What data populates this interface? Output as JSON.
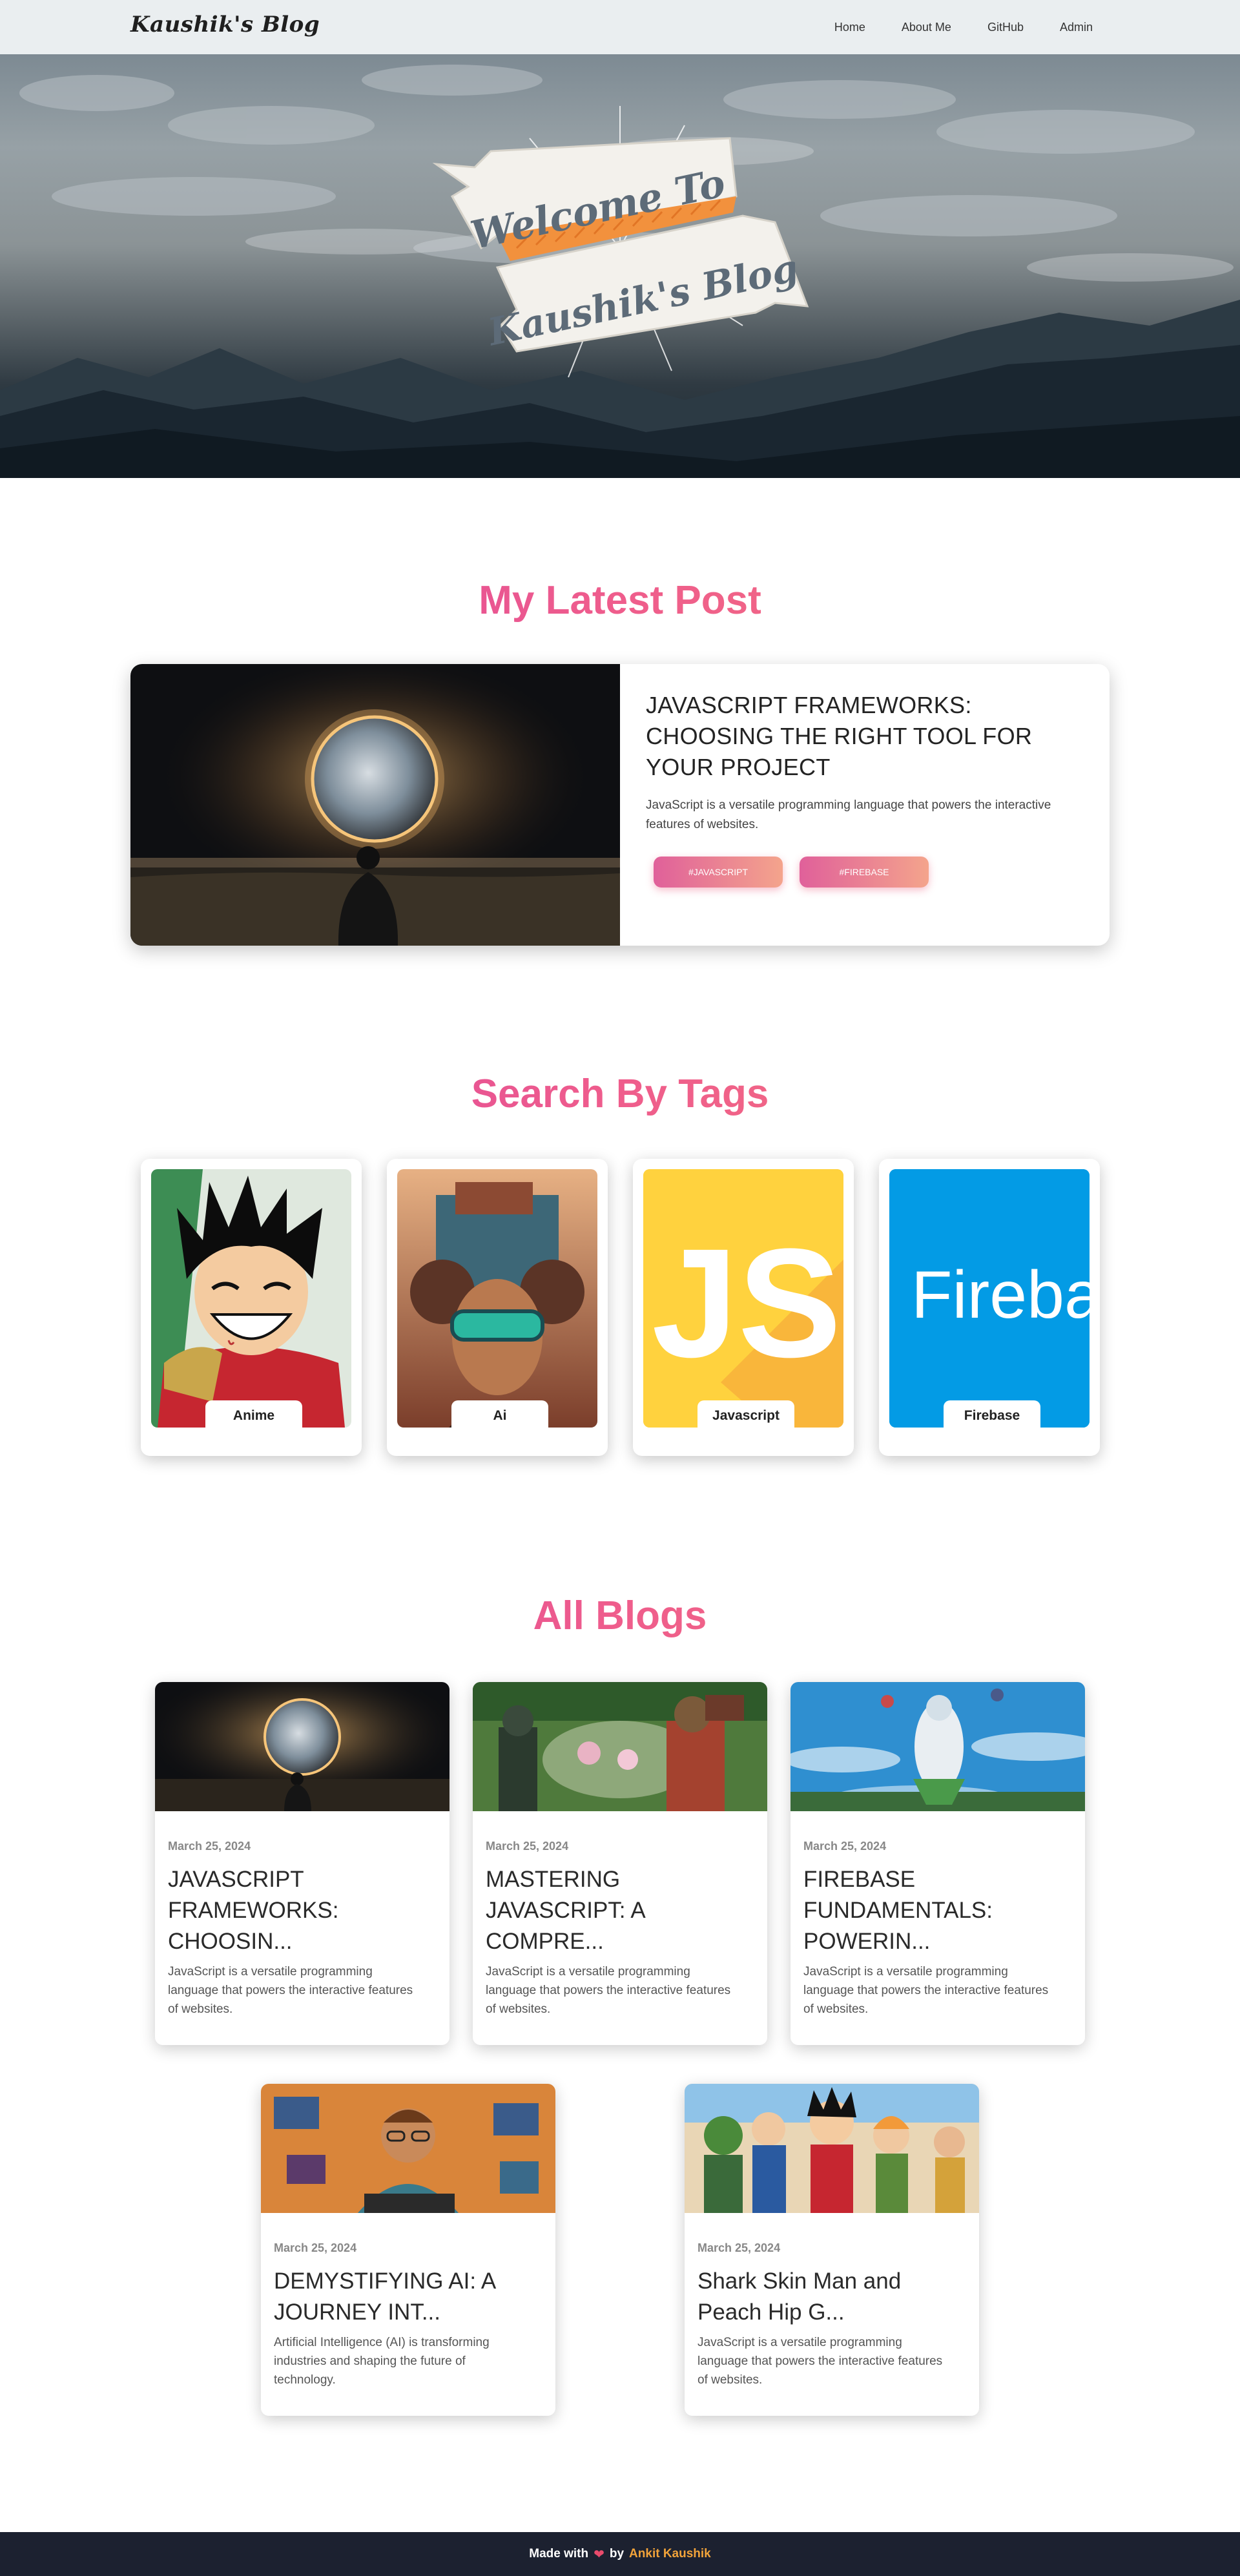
{
  "navbar": {
    "brand": "Kaushik's Blog",
    "links": [
      "Home",
      "About Me",
      "GitHub",
      "Admin"
    ]
  },
  "hero": {
    "banner_line1": "Welcome To",
    "banner_line2": "Kaushik's Blog"
  },
  "latest": {
    "heading": "My Latest Post",
    "title": "JAVASCRIPT FRAMEWORKS: CHOOSING THE RIGHT TOOL FOR YOUR PROJECT",
    "description": "JavaScript is a versatile programming language that powers the interactive features of websites.",
    "tags": [
      "#JAVASCRIPT",
      "#FIREBASE"
    ]
  },
  "tags_section": {
    "heading": "Search By Tags",
    "items": [
      {
        "label": "Anime"
      },
      {
        "label": "Ai"
      },
      {
        "label": "Javascript"
      },
      {
        "label": "Firebase"
      }
    ],
    "js_logo_text": "JS",
    "firebase_logo_text": "Fireba"
  },
  "blogs_section": {
    "heading": "All Blogs",
    "posts": [
      {
        "date": "March 25, 2024",
        "title": "JAVASCRIPT FRAMEWORKS: CHOOSIN...",
        "description": "JavaScript is a versatile programming language that powers the interactive features of websites."
      },
      {
        "date": "March 25, 2024",
        "title": "MASTERING JAVASCRIPT: A COMPRE...",
        "description": "JavaScript is a versatile programming language that powers the interactive features of websites."
      },
      {
        "date": "March 25, 2024",
        "title": "FIREBASE FUNDAMENTALS: POWERIN...",
        "description": "JavaScript is a versatile programming language that powers the interactive features of websites."
      },
      {
        "date": "March 25, 2024",
        "title": "DEMYSTIFYING AI: A JOURNEY INT...",
        "description": "Artificial Intelligence (AI) is transforming industries and shaping the future of technology."
      },
      {
        "date": "March 25, 2024",
        "title": "Shark Skin Man and Peach Hip G...",
        "description": "JavaScript is a versatile programming language that powers the interactive features of websites."
      }
    ]
  },
  "footer": {
    "made_with": "Made with",
    "by": "by",
    "author": "Ankit Kaushik"
  }
}
